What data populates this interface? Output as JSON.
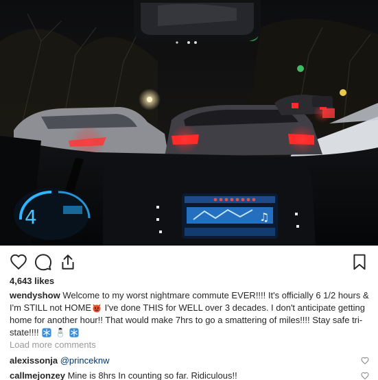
{
  "post": {
    "image_icon": "photo-of-snowy-traffic-jam-from-car",
    "likes_text": "4,643 likes"
  },
  "actions": {
    "like_icon": "heart-outline-icon",
    "comment_icon": "speech-bubble-icon",
    "share_icon": "share-arrow-icon",
    "save_icon": "bookmark-icon"
  },
  "caption": {
    "username": "wendyshow",
    "text_part1": "Welcome to my worst nightmare commute EVER!!!! It's officially 6 1/2 hours & I'm STILL not HOME",
    "emoji1_icon": "angry-devil-face-icon",
    "text_part2": "I've done THIS for WELL over 3 decades. I don't anticipate getting home for another hour!! That would make 7hrs to go a smattering of miles!!!! Stay safe tri-state!!!!",
    "emoji2_icon": "snowflake-icon",
    "emoji3_icon": "snowman-icon",
    "emoji4_icon": "snowflake-icon"
  },
  "load_more": "Load more comments",
  "comments": [
    {
      "username": "alexissonja",
      "mention": "@princeknw",
      "text": ""
    },
    {
      "username": "callmejonzey",
      "mention": "",
      "text": "Mine is 8hrs In counting so far. Ridiculous!!"
    }
  ],
  "colors": {
    "text": "#262626",
    "muted": "#999999",
    "mention": "#003569",
    "brake_light": "#ff2a2a",
    "dashboard_blue": "#2fb6ff"
  }
}
